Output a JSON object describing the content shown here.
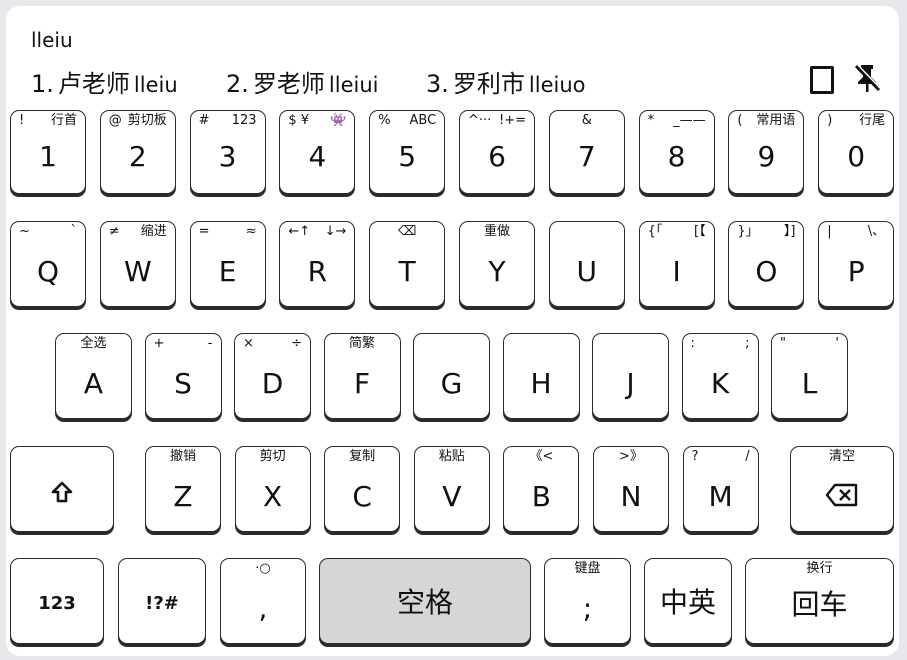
{
  "composition": "lleiu",
  "candidates": [
    {
      "index": "1.",
      "hanzi": "卢老师",
      "code": "lleiu"
    },
    {
      "index": "2.",
      "hanzi": "罗老师",
      "code": "lleiui"
    },
    {
      "index": "3.",
      "hanzi": "罗利市",
      "code": "lleiuo"
    }
  ],
  "toolbar_icons": [
    "window-mode-icon",
    "unpin-icon"
  ],
  "rows": {
    "numbers": [
      {
        "main": "1",
        "sub_left": "!",
        "sub_right": "行首"
      },
      {
        "main": "2",
        "sub_left": "@",
        "sub_right": "剪切板"
      },
      {
        "main": "3",
        "sub_left": "#",
        "sub_right": "123"
      },
      {
        "main": "4",
        "sub_left": "$ ¥",
        "sub_right": "👾"
      },
      {
        "main": "5",
        "sub_left": "%",
        "sub_right": "ABC"
      },
      {
        "main": "6",
        "sub_left": "^···",
        "sub_right": "!+="
      },
      {
        "main": "7",
        "sub_center": "&"
      },
      {
        "main": "8",
        "sub_left": "*",
        "sub_right": "_——"
      },
      {
        "main": "9",
        "sub_left": "(",
        "sub_right": "常用语"
      },
      {
        "main": "0",
        "sub_left": ")",
        "sub_right": "行尾"
      }
    ],
    "top": [
      {
        "main": "Q",
        "sub_left": "~",
        "sub_right": "`"
      },
      {
        "main": "W",
        "sub_left": "≠",
        "sub_right": "缩进"
      },
      {
        "main": "E",
        "sub_left": "=",
        "sub_right": "≈"
      },
      {
        "main": "R",
        "sub_left": "←↑",
        "sub_right": "↓→"
      },
      {
        "main": "T",
        "sub_center": "⌫"
      },
      {
        "main": "Y",
        "sub_center": "重做"
      },
      {
        "main": "U"
      },
      {
        "main": "I",
        "sub_left": "{「",
        "sub_right": "[【"
      },
      {
        "main": "O",
        "sub_left": "}」",
        "sub_right": "】]"
      },
      {
        "main": "P",
        "sub_left": "|",
        "sub_right": "\\、"
      }
    ],
    "home": [
      {
        "main": "A",
        "sub_center": "全选"
      },
      {
        "main": "S",
        "sub_left": "+",
        "sub_right": "-"
      },
      {
        "main": "D",
        "sub_left": "×",
        "sub_right": "÷"
      },
      {
        "main": "F",
        "sub_center": "简繁"
      },
      {
        "main": "G"
      },
      {
        "main": "H"
      },
      {
        "main": "J"
      },
      {
        "main": "K",
        "sub_left": ":",
        "sub_right": ";"
      },
      {
        "main": "L",
        "sub_left": "\"",
        "sub_right": "'"
      }
    ],
    "bottom": [
      {
        "main": "Z",
        "sub_center": "撤销"
      },
      {
        "main": "X",
        "sub_center": "剪切"
      },
      {
        "main": "C",
        "sub_center": "复制"
      },
      {
        "main": "V",
        "sub_center": "粘贴"
      },
      {
        "main": "B",
        "sub_center": "《<"
      },
      {
        "main": "N",
        "sub_center": ">》"
      },
      {
        "main": "M",
        "sub_left": "?",
        "sub_right": "/"
      }
    ],
    "backspace": {
      "sub_center": "清空"
    },
    "func": {
      "num_label": "123",
      "sym_label": "!?#",
      "comma_main": ",",
      "comma_sub": "·○",
      "space_label": "空格",
      "semicolon_main": ";",
      "semicolon_sub": "键盘",
      "lang_label": "中英",
      "enter_main": "回车",
      "enter_sub": "换行"
    }
  },
  "colors": {
    "key_bg": "#ffffff",
    "space_bg": "#d6d6d6",
    "border": "#2b2b2b",
    "panel": "#e8e8ec"
  }
}
